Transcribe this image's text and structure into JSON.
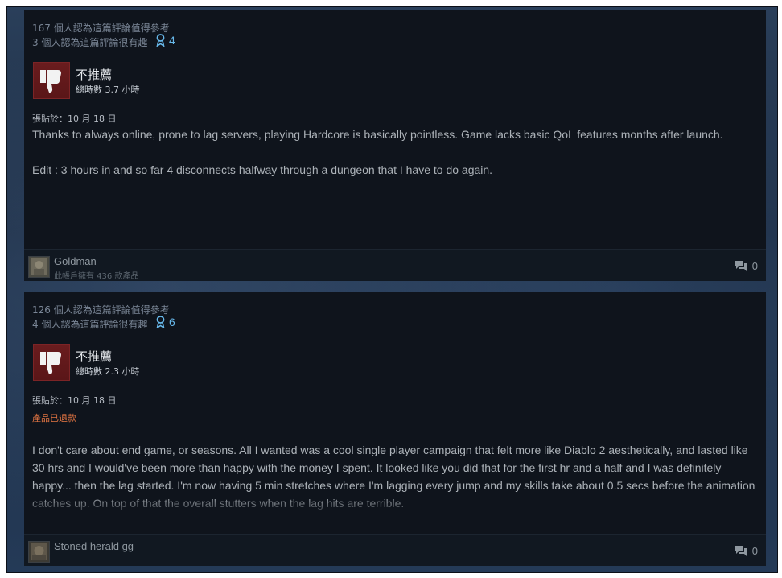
{
  "reviews": [
    {
      "helpful": "167 個人認為這篇評論值得參考",
      "funny": "3 個人認為這篇評論很有趣",
      "awards": "4",
      "recommendation": "不推薦",
      "hours": "總時數 3.7 小時",
      "posted": "張貼於：10 月 18 日",
      "refunded": "",
      "paragraphs": [
        "Thanks to always online, prone to lag servers, playing Hardcore is basically pointless. Game lacks basic QoL features months after launch.",
        "Edit : 3 hours in and so far 4 disconnects halfway through a dungeon that I have to do again."
      ],
      "author": "Goldman",
      "owned": "此帳戶擁有 436 款產品",
      "comments": "0"
    },
    {
      "helpful": "126 個人認為這篇評論值得參考",
      "funny": "4 個人認為這篇評論很有趣",
      "awards": "6",
      "recommendation": "不推薦",
      "hours": "總時數 2.3 小時",
      "posted": "張貼於：10 月 18 日",
      "refunded": "產品已退款",
      "paragraphs": [
        "I don't care about end game, or seasons. All I wanted was a cool single player campaign that felt more like Diablo 2 aesthetically, and lasted like 30 hrs and I would've been more than happy with the money I spent. It looked like you did that for the first hr and a half and I was definitely happy... then the lag started. I'm now having 5 min stretches where I'm lagging every jump and my skills take about 0.5 secs before the animation catches up. On top of that the overall stutters when the lag hits are terrible."
      ],
      "author": "Stoned herald gg",
      "owned": "",
      "comments": "0"
    }
  ],
  "icons": {
    "thumb": "thumbs-down-icon",
    "award": "award-ribbon-icon",
    "comment": "comment-bubble-icon"
  },
  "colors": {
    "card_bg": "#0f141c",
    "thumb_bg": "#6a1c1e",
    "award": "#67b8ea",
    "refunded": "#e17442",
    "text": "#acb2b8"
  }
}
